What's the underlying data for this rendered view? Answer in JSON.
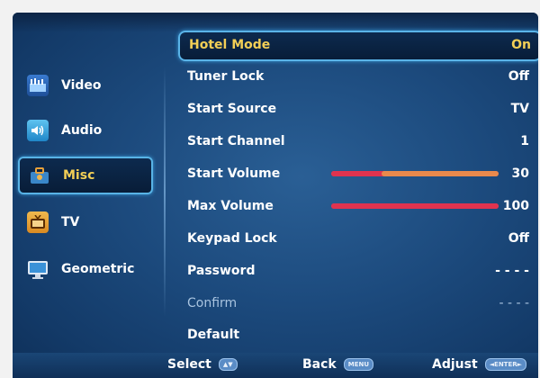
{
  "sidebar": {
    "items": [
      {
        "label": "Video",
        "icon": "video-icon"
      },
      {
        "label": "Audio",
        "icon": "audio-icon"
      },
      {
        "label": "Misc",
        "icon": "misc-icon",
        "selected": true
      },
      {
        "label": "TV",
        "icon": "tv-icon"
      },
      {
        "label": "Geometric",
        "icon": "geometric-icon"
      }
    ]
  },
  "menu": {
    "rows": [
      {
        "label": "Hotel Mode",
        "value": "On"
      },
      {
        "label": "Tuner Lock",
        "value": "Off"
      },
      {
        "label": "Start Source",
        "value": "TV"
      },
      {
        "label": "Start Channel",
        "value": "1"
      },
      {
        "label": "Start Volume",
        "value": "30",
        "level": 30
      },
      {
        "label": "Max Volume",
        "value": "100",
        "level": 100
      },
      {
        "label": "Keypad Lock",
        "value": "Off"
      },
      {
        "label": "Password",
        "value": "- - - -"
      },
      {
        "label": "Confirm",
        "value": "- - - -"
      },
      {
        "label": "Default",
        "value": ""
      }
    ]
  },
  "footer": {
    "select_label": "Select",
    "select_key": "▲▼",
    "back_label": "Back",
    "back_key": "MENU",
    "adjust_label": "Adjust",
    "adjust_key": "◄ENTER►"
  },
  "colors": {
    "highlight_text": "#f3cf56",
    "selection_border": "#58b3e6",
    "volume_bar": "#e0334f",
    "volume_bar_rest": "#e9894c"
  }
}
